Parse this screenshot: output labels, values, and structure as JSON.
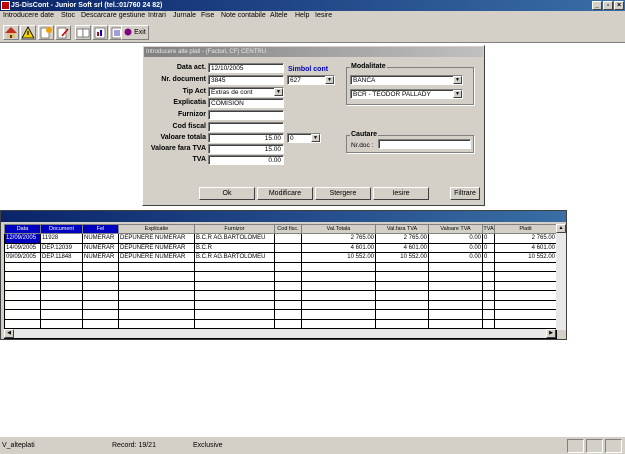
{
  "window": {
    "title": "JS-DisCont - Junior Soft srl (tel.:01/760 24 82)",
    "btn_min": "_",
    "btn_max": "▫",
    "btn_close": "×"
  },
  "menu": [
    "Introducere date",
    "Stoc",
    "Descarcare gestiune",
    "Intrari",
    "Jurnale",
    "Fise",
    "Note contabile",
    "Altele",
    "Help",
    "Iesire"
  ],
  "toolbar": {
    "exit_label": "Exit"
  },
  "dialog": {
    "title": "Introducere alte plati - (Facturi, CF)    CENTRU",
    "labels": {
      "data_act": "Data act.",
      "nr_document": "Nr. document",
      "tip_act": "Tip Act",
      "explicatia": "Explicatia",
      "furnizor": "Furnizor",
      "cod_fiscal": "Cod fiscal",
      "valoare_totala": "Valoare totala",
      "valoare_fara_tva": "Valoare fara TVA",
      "tva": "TVA",
      "simbol_cont": "Simbol cont",
      "modalitate": "Modalitate",
      "cautare": "Cautare",
      "nr_doc": "Nr.doc :"
    },
    "values": {
      "data_act": "12/10/2005",
      "nr_document": "3845",
      "tip_act": "Extras de cont",
      "explicatia": "COMISION",
      "furnizor": "",
      "cod_fiscal": "",
      "valoare_totala": "15.00",
      "tva_rate": "0",
      "valoare_fara_tva": "15.00",
      "tva": "0.00",
      "simbol_cont": "627",
      "modalitate": "BANCA",
      "banca": "BCR - TEODOR PALLADY",
      "nr_doc": ""
    },
    "buttons": {
      "ok": "Ok",
      "modificare": "Modificare",
      "stergere": "Stergere",
      "iesire": "Iesire",
      "filtrare": "Filtrare"
    }
  },
  "grid": {
    "columns": [
      "Data",
      "Document",
      "Fel",
      "Explicatie",
      "Furnizor",
      "Cod fisc.",
      "Val.Totala",
      "Val.fara TVA",
      "Valoare TVA",
      "TVA",
      "Platit"
    ],
    "rows": [
      [
        "12/09/2005",
        "11928",
        "NUMERAR",
        "DEPUNERE NUMERAR",
        "B.C.R AG.BARTOLOMEU",
        "",
        "2 765.00",
        "2 765.00",
        "0.00",
        "0",
        "2 765.00"
      ],
      [
        "14/09/2005",
        "DEP.12039",
        "NUMERAR",
        "DEPUNERE NUMERAR",
        "B.C.R",
        "",
        "4 601.00",
        "4 601.00",
        "0.00",
        "0",
        "4 601.00"
      ],
      [
        "09/09/2005",
        "DEP.11848",
        "NUMERAR",
        "DEPUNERE NUMERAR",
        "B.C.R AG.BARTOLOMEU",
        "",
        "10 552.00",
        "10 552.00",
        "0.00",
        "0",
        "10 552.00"
      ]
    ]
  },
  "status": {
    "table": "V_alteplati",
    "record": "Record: 19/21",
    "mode": "Exclusive"
  }
}
